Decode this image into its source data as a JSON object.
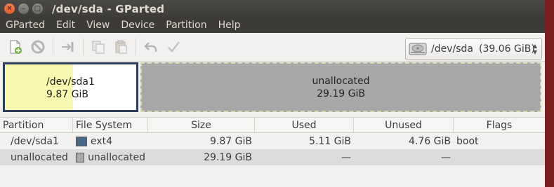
{
  "window": {
    "title": "/dev/sda - GParted"
  },
  "menubar": {
    "items": [
      "GParted",
      "Edit",
      "View",
      "Device",
      "Partition",
      "Help"
    ]
  },
  "toolbar": {
    "icons": [
      "new-partition-icon",
      "delete-icon",
      "resize-move-icon",
      "copy-icon",
      "paste-icon",
      "undo-icon",
      "apply-icon"
    ],
    "device": {
      "name": "/dev/sda",
      "size": "(39.06 GiB)"
    }
  },
  "disk_map": {
    "partition": {
      "name": "/dev/sda1",
      "size": "9.87 GiB",
      "used_fraction": 0.52,
      "color": "#f8f8b0",
      "border": "#2c3e5a"
    },
    "unallocated": {
      "name": "unallocated",
      "size": "29.19 GiB",
      "color": "#a8a8a8"
    }
  },
  "table": {
    "headers": [
      "Partition",
      "File System",
      "Size",
      "Used",
      "Unused",
      "Flags"
    ],
    "rows": [
      {
        "partition": "/dev/sda1",
        "fs": "ext4",
        "fs_color": "#4a6784",
        "size": "9.87 GiB",
        "used": "5.11 GiB",
        "unused": "4.76 GiB",
        "flags": "boot"
      },
      {
        "partition": "unallocated",
        "fs": "unallocated",
        "fs_color": "#a8a8a8",
        "size": "29.19 GiB",
        "used": "—",
        "unused": "—",
        "flags": ""
      }
    ]
  }
}
